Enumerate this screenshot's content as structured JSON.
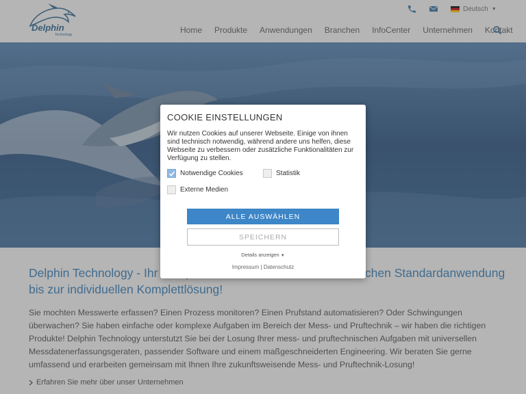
{
  "header": {
    "logo_text": "Delphin",
    "logo_sub": "Technology",
    "language": "Deutsch",
    "nav": [
      "Home",
      "Produkte",
      "Anwendungen",
      "Branchen",
      "InfoCenter",
      "Unternehmen",
      "Kontakt"
    ],
    "icons": [
      "phone-icon",
      "mail-icon",
      "flag-de-icon",
      "search-icon"
    ]
  },
  "content": {
    "title": "Delphin Technology - Ihr Komplettanbieter von der messtechnischen Standardanwendung bis zur individuellen Komplettlösung!",
    "text": "Sie mochten Messwerte erfassen? Einen Prozess monitoren? Einen Prufstand automatisieren? Oder Schwingungen überwachen? Sie haben einfache oder komplexe Aufgaben im Bereich der Mess- und Pruftechnik – wir haben die richtigen Produkte! Delphin Technology unterstutzt Sie bei der Losung Ihrer mess- und pruftechnischen Aufgaben mit universellen Messdatenerfassungsgeraten, passender Software und einem maßgeschneiderten Engineering. Wir beraten Sie gerne umfassend und erarbeiten gemeinsam mit Ihnen Ihre zukunftsweisende Mess- und Pruftechnik-Losung!",
    "more_link": "Erfahren Sie mehr über unser Unternehmen"
  },
  "cookie": {
    "title": "COOKIE EINSTELLUNGEN",
    "description": "Wir nutzen Cookies auf unserer Webseite. Einige von ihnen sind technisch notwendig, während andere uns helfen, diese Webseite zu verbessern oder zusätzliche Funktionalitäten zur Verfügung zu stellen.",
    "options": {
      "necessary": {
        "label": "Notwendige Cookies",
        "checked": true
      },
      "statistics": {
        "label": "Statistik",
        "checked": false
      },
      "external": {
        "label": "Externe Medien",
        "checked": false
      }
    },
    "select_all": "ALLE AUSWÄHLEN",
    "save": "SPEICHERN",
    "details": "Details anzeigen",
    "imprint": "Impressum",
    "separator": "|",
    "privacy": "Datenschutz"
  },
  "colors": {
    "accent": "#3d86c7",
    "title_blue": "#2a79b8",
    "logo_blue": "#1f5f8f"
  }
}
